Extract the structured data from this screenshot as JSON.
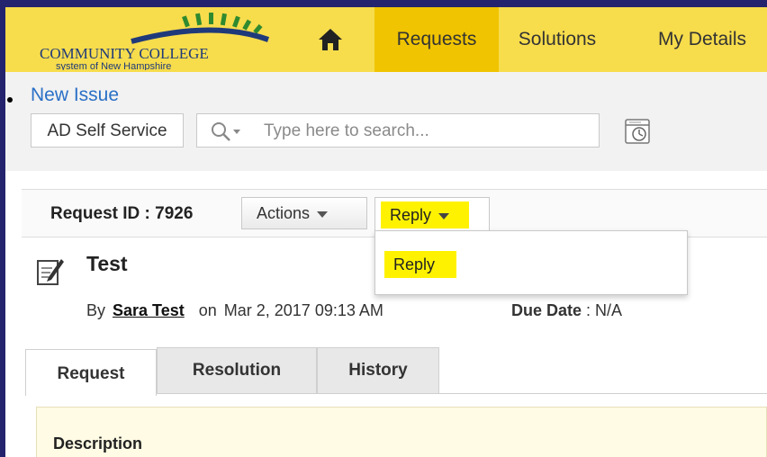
{
  "header": {
    "logo_line1": "COMMUNITY COLLEGE",
    "logo_line2": "system of New Hampshire",
    "nav": [
      {
        "label": "Requests",
        "active": true
      },
      {
        "label": "Solutions",
        "active": false
      },
      {
        "label": "My Details",
        "active": false
      }
    ]
  },
  "toolbar": {
    "new_issue": "New Issue",
    "ad_button": "AD Self Service",
    "search_placeholder": "Type here to search..."
  },
  "request": {
    "id_label": "Request ID : 7926",
    "actions_label": "Actions",
    "reply_label": "Reply",
    "dropdown_items": [
      "Reply"
    ],
    "title": "Test",
    "by_prefix": "By",
    "author": "Sara Test",
    "on_prefix": "on",
    "date": "Mar 2, 2017 09:13 AM",
    "due_label": "Due Date",
    "due_value": " : N/A"
  },
  "tabs": [
    {
      "label": "Request",
      "active": true
    },
    {
      "label": "Resolution",
      "active": false
    },
    {
      "label": "History",
      "active": false
    }
  ],
  "description_label": "Description",
  "colors": {
    "header_bg": "#f7dc4c",
    "nav_active": "#f0c400",
    "highlight": "#fff200",
    "link": "#2a70c6",
    "frame": "#24246e"
  }
}
